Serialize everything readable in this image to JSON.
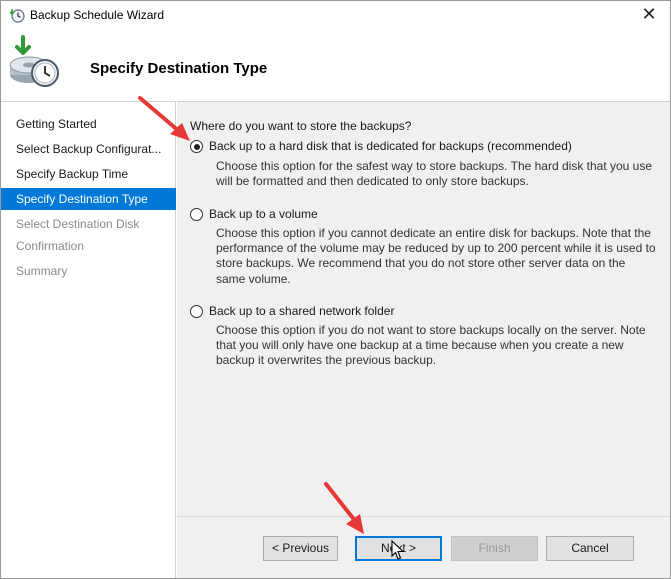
{
  "window": {
    "title": "Backup Schedule Wizard",
    "close_glyph": "✕"
  },
  "header": {
    "title": "Specify Destination Type"
  },
  "sidebar": {
    "items": [
      {
        "label": "Getting Started",
        "state": "normal"
      },
      {
        "label": "Select Backup Configurat...",
        "state": "normal"
      },
      {
        "label": "Specify Backup Time",
        "state": "normal"
      },
      {
        "label": "Specify Destination Type",
        "state": "active"
      },
      {
        "label": "Select Destination Disk",
        "state": "disabled"
      },
      {
        "label": "Confirmation",
        "state": "disabled"
      },
      {
        "label": "Summary",
        "state": "disabled"
      }
    ]
  },
  "content": {
    "question": "Where do you want to store the backups?",
    "options": [
      {
        "label": "Back up to a hard disk that is dedicated for backups (recommended)",
        "checked": true,
        "description": "Choose this option for the safest way to store backups. The hard disk that you use will be formatted and then dedicated to only store backups."
      },
      {
        "label": "Back up to a volume",
        "checked": false,
        "description": "Choose this option if you cannot dedicate an entire disk for backups. Note that the performance of the volume may be reduced by up to 200 percent while it is used to store backups. We recommend that you do not store other server data on the same volume."
      },
      {
        "label": "Back up to a shared network folder",
        "checked": false,
        "description": "Choose this option if you do not want to store backups locally on the server. Note that you will only have one backup at a time because when you create a new backup it overwrites the previous backup."
      }
    ]
  },
  "footer": {
    "previous_label": "< Previous",
    "next_label": "Next >",
    "finish_label": "Finish",
    "cancel_label": "Cancel"
  },
  "colors": {
    "accent": "#0078d7",
    "annotation_arrow": "#e53935"
  }
}
